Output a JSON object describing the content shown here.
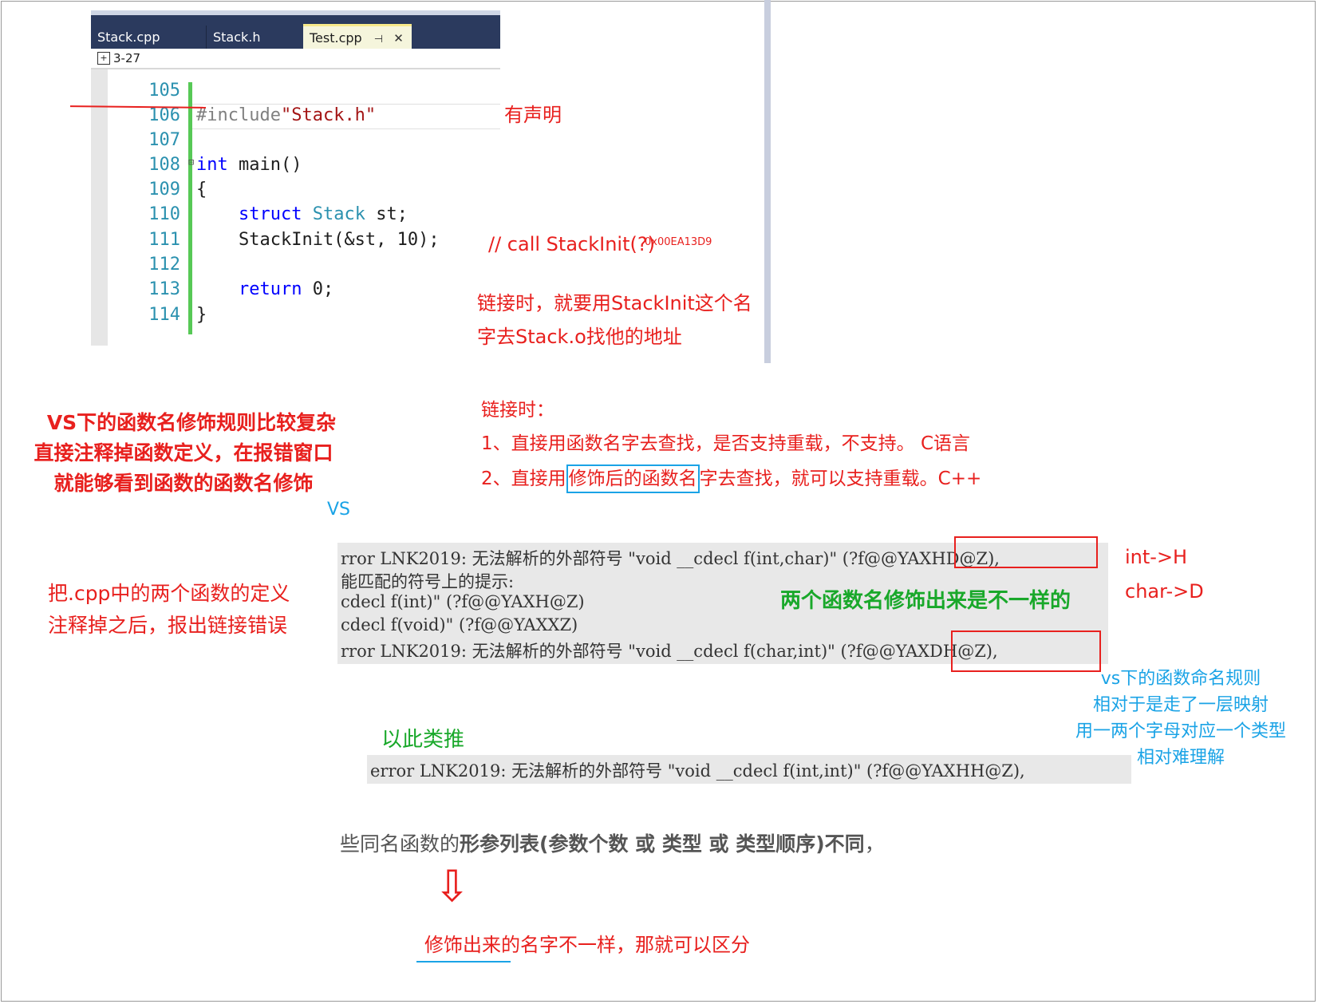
{
  "ide": {
    "tabs": [
      "Stack.cpp",
      "Stack.h",
      "Test.cpp"
    ],
    "active_tab_pin": "⊣",
    "active_tab_close": "✕",
    "nav_project": "3-27",
    "lines": [
      {
        "num": "105",
        "code": ""
      },
      {
        "num": "106",
        "code": "#include\"Stack.h\""
      },
      {
        "num": "107",
        "code": ""
      },
      {
        "num": "108",
        "code": "int main()"
      },
      {
        "num": "109",
        "code": "{"
      },
      {
        "num": "110",
        "code": "    struct Stack st;"
      },
      {
        "num": "111",
        "code": "    StackInit(&st, 10);"
      },
      {
        "num": "112",
        "code": ""
      },
      {
        "num": "113",
        "code": "    return 0;"
      },
      {
        "num": "114",
        "code": "}"
      }
    ],
    "colors": {
      "tabbar": "#2b3a5e",
      "active_tab": "#f5f5dc",
      "line_numbers": "#2b91af",
      "keyword": "#0000ff",
      "string": "#a31515",
      "change_bar": "#57c956"
    }
  },
  "annotations": {
    "has_declaration": "有声明",
    "call_comment": "// call  StackInit(?)",
    "call_address": "0x00EA13D9",
    "link_note_1": "链接时，就要用StackInit这个名",
    "link_note_2": "字去Stack.o找他的地址",
    "link_title": "链接时：",
    "link_item_1": "1、直接用函数名字去查找，是否支持重载，不支持。   C语言",
    "link_item_2_a": "2、直接用",
    "link_item_2_b": "修饰后的函数名",
    "link_item_2_c": "字去查找，就可以支持重载。C++",
    "vs_rule_1": "VS下的函数名修饰规则比较复杂",
    "vs_rule_2": "直接注释掉函数定义，在报错窗口",
    "vs_rule_3": "就能够看到函数的函数名修饰",
    "vs_label": "VS",
    "comment_out_1": "把.cpp中的两个函数的定义",
    "comment_out_2": "注释掉之后，报出链接错误",
    "different": "两个函数名修饰出来是不一样的",
    "int_map": "int->H",
    "char_map": "char->D",
    "vs_naming_1": "vs下的函数命名规则",
    "vs_naming_2": "相对于是走了一层映射",
    "vs_naming_3": "用一两个字母对应一个类型",
    "vs_naming_4": "相对难理解",
    "by_analogy": "以此类推",
    "overload_sentence_a": "些同名函数的",
    "overload_sentence_b": "形参列表(参数个数 或 类型 或 类型顺序)不同",
    "overload_sentence_c": "，",
    "arrow": "⇩",
    "conclusion": "修饰出来的名字不一样，那就可以区分"
  },
  "errors": {
    "block1": [
      "rror LNK2019: 无法解析的外部符号 \"void __cdecl f(int,char)\" (?f@@YAXHD@Z),",
      "能匹配的符号上的提示:",
      "cdecl f(int)\" (?f@@YAXH@Z)",
      "cdecl f(void)\" (?f@@YAXXZ)",
      "rror LNK2019: 无法解析的外部符号 \"void __cdecl f(char,int)\" (?f@@YAXDH@Z),"
    ],
    "block2": [
      "error LNK2019: 无法解析的外部符号 \"void __cdecl f(int,int)\" (?f@@YAXHH@Z),"
    ]
  }
}
